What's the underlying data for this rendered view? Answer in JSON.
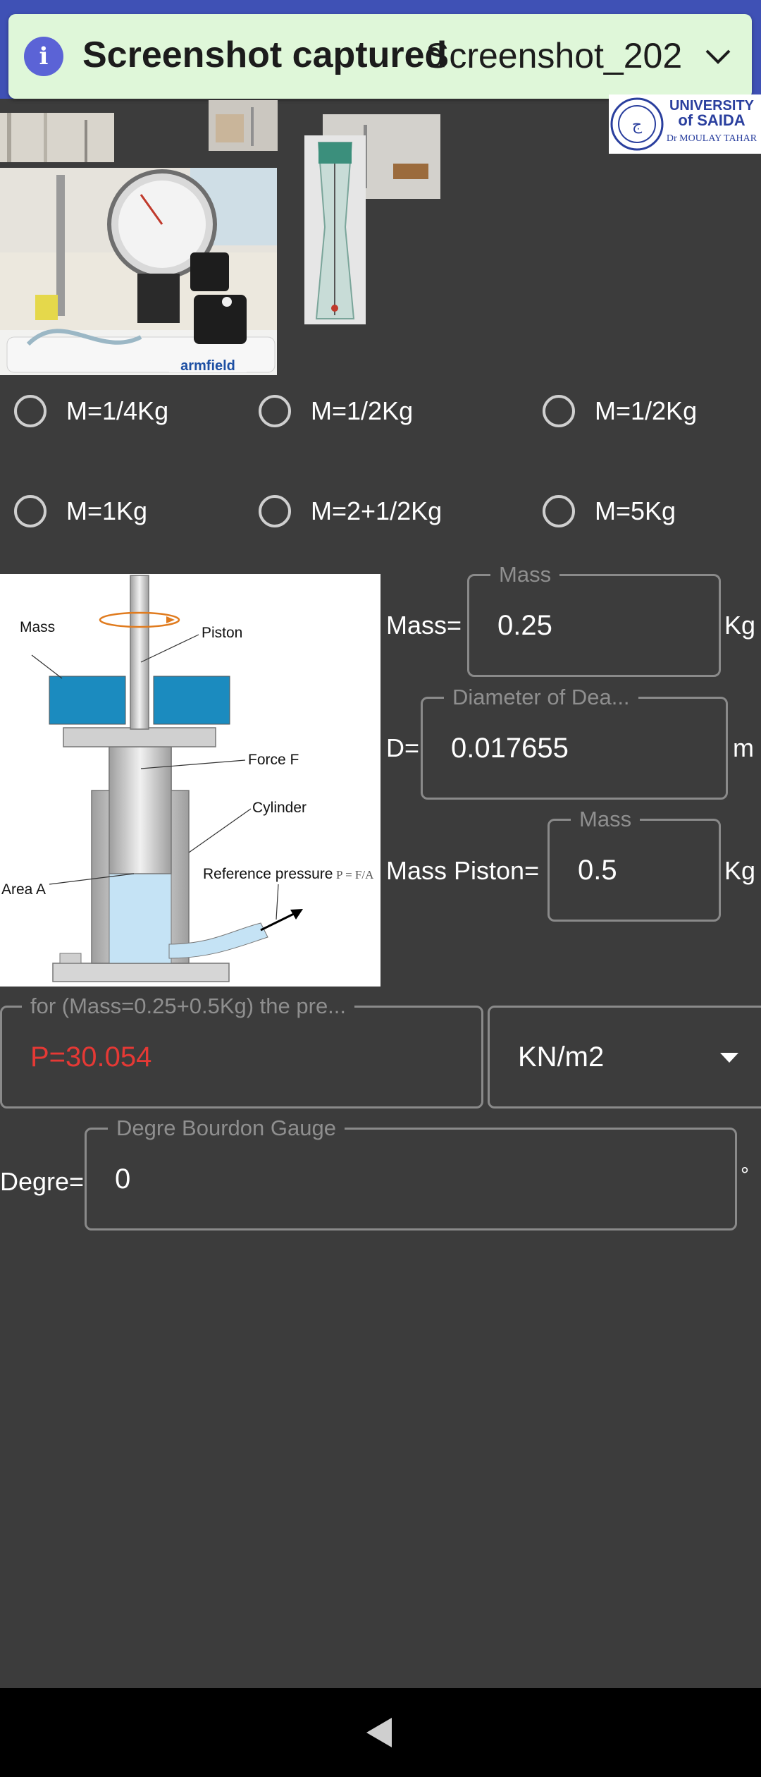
{
  "notification": {
    "title": "Screenshot captured",
    "filename": "Screenshot_202"
  },
  "logo": {
    "line1": "UNIVERSITY",
    "line2": "of SAIDA",
    "line3": "Dr MOULAY TAHAR"
  },
  "apparatus_photo": {
    "brand": "armfield"
  },
  "mass_options": [
    {
      "label": "M=1/4Kg"
    },
    {
      "label": "M=1/2Kg"
    },
    {
      "label": "M=1/2Kg"
    },
    {
      "label": "M=1Kg"
    },
    {
      "label": "M=2+1/2Kg"
    },
    {
      "label": "M=5Kg"
    }
  ],
  "diagram": {
    "mass": "Mass",
    "piston": "Piston",
    "force": "Force F",
    "cylinder": "Cylinder",
    "area": "Area A",
    "reference": "Reference pressure",
    "formula": "P = F/A"
  },
  "mass_field": {
    "prefix": "Mass=",
    "legend": "Mass",
    "value": "0.25",
    "unit": "Kg"
  },
  "diameter_field": {
    "prefix": "D=",
    "legend": "Diameter of Dea...",
    "value": "0.017655",
    "unit": "m"
  },
  "piston_field": {
    "prefix": "Mass Piston=",
    "legend": "Mass",
    "value": "0.5",
    "unit": "Kg"
  },
  "pressure_field": {
    "legend": "for (Mass=0.25+0.5Kg) the pre...",
    "value": "P=30.054"
  },
  "unit_select": {
    "selected": "KN/m2"
  },
  "degree_field": {
    "prefix": "Degre=",
    "legend": "Degre Bourdon Gauge",
    "value": "0",
    "unit": "°"
  },
  "colors": {
    "accent": "#3f51b5",
    "pressure_value": "#e53935",
    "notification_bg": "#dff7d9",
    "diagram_blue": "#1b8bbf"
  }
}
